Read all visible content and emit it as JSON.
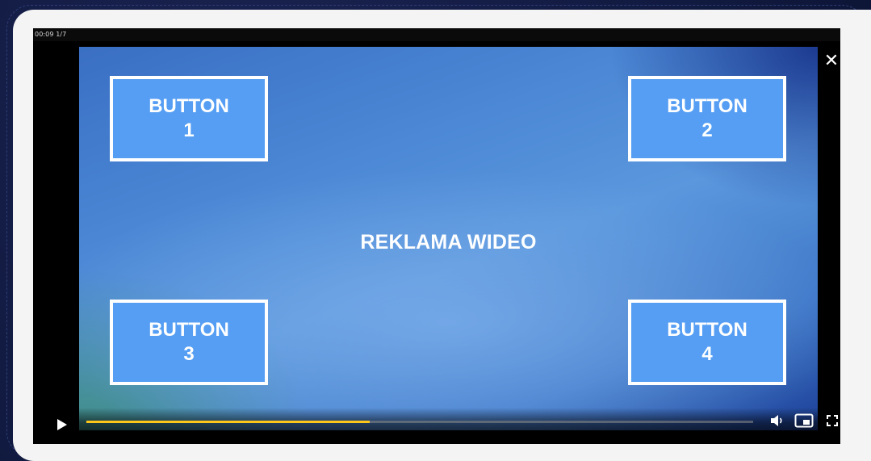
{
  "player": {
    "timer": "00:09 1/7",
    "progress_percent": 42.5
  },
  "ad": {
    "title": "REKLAMA WIDEO",
    "buttons": [
      {
        "line1": "BUTTON",
        "line2": "1"
      },
      {
        "line1": "BUTTON",
        "line2": "2"
      },
      {
        "line1": "BUTTON",
        "line2": "3"
      },
      {
        "line1": "BUTTON",
        "line2": "4"
      }
    ]
  },
  "controls": {
    "close_icon": "close-icon",
    "play_icon": "play-icon",
    "volume_icon": "volume-icon",
    "pip_icon": "picture-in-picture-icon",
    "fullscreen_icon": "fullscreen-icon"
  },
  "colors": {
    "accent_progress": "#ffc61a",
    "button_fill": "#559ef3",
    "page_background": "#0f1738",
    "card_background": "#f4f4f4"
  }
}
